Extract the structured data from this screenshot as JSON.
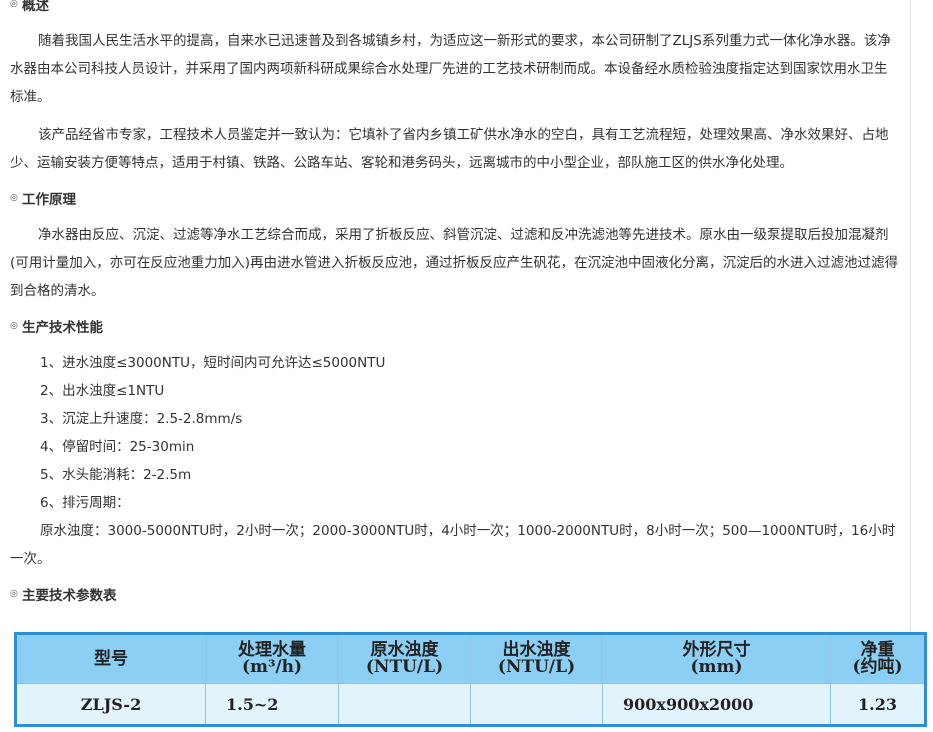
{
  "sections": {
    "overview": {
      "title": "概述",
      "paragraphs": [
        "随着我国人民生活水平的提高，自来水已迅速普及到各城镇乡村，为适应这一新形式的要求，本公司研制了ZLJS系列重力式一体化净水器。该净水器由本公司科技人员设计，并采用了国内两项新科研成果综合水处理厂先进的工艺技术研制而成。本设备经水质检验浊度指定达到国家饮用水卫生标准。",
        "该产品经省市专家，工程技术人员鉴定并一致认为：它填补了省内乡镇工矿供水净水的空白，具有工艺流程短，处理效果高、净水效果好、占地少、运输安装方便等特点，适用于村镇、铁路、公路车站、客轮和港务码头，远离城市的中小型企业，部队施工区的供水净化处理。"
      ]
    },
    "principle": {
      "title": "工作原理",
      "paragraph": "净水器由反应、沉淀、过滤等净水工艺综合而成，采用了折板反应、斜管沉淀、过滤和反冲洗滤池等先进技术。原水由一级泵提取后投加混凝剂(可用计量加入，亦可在反应池重力加入)再由进水管进入折板反应池，通过折板反应产生矾花，在沉淀池中固液化分离，沉淀后的水进入过滤池过滤得到合格的清水。"
    },
    "performance": {
      "title": "生产技术性能",
      "items": [
        "1、进水浊度≤3000NTU，短时间内可允许达≤5000NTU",
        "2、出水浊度≤1NTU",
        "3、沉淀上升速度：2.5-2.8mm/s",
        "4、停留时间：25-30min",
        "5、水头能消耗：2-2.5m",
        "6、排污周期："
      ],
      "note": "原水浊度：3000-5000NTU时，2小时一次；2000-3000NTU时，4小时一次；1000-2000NTU时，8小时一次；500—1000NTU时，16小时一次。"
    },
    "specs": {
      "title": "主要技术参数表",
      "headers": [
        {
          "line1": "型号",
          "line2": ""
        },
        {
          "line1": "处理水量",
          "line2": "(m³/h)"
        },
        {
          "line1": "原水浊度",
          "line2": "(NTU/L)"
        },
        {
          "line1": "出水浊度",
          "line2": "(NTU/L)"
        },
        {
          "line1": "外形尺寸",
          "line2": "(mm)"
        },
        {
          "line1": "净重",
          "line2": "(约吨)"
        }
      ],
      "rows": [
        [
          "ZLJS-2",
          "1.5~2",
          "",
          "",
          "900x900x2000",
          "1.23"
        ]
      ]
    }
  },
  "colors": {
    "table_border": "#2f8fd6",
    "header_bg": "#8ccff4",
    "row_bg": "#e3f3fc"
  }
}
